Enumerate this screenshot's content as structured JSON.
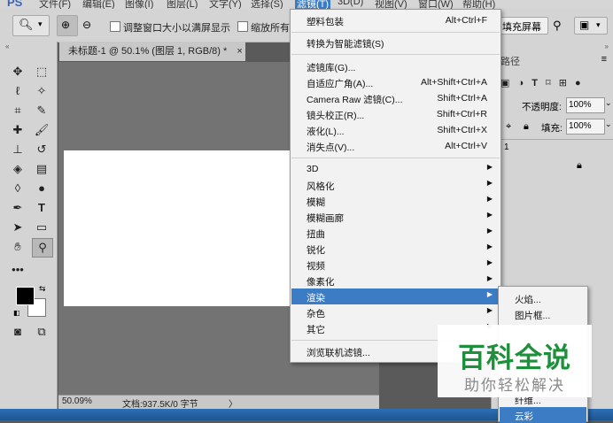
{
  "menubar": {
    "app_logo": "PS",
    "items": [
      "文件(F)",
      "编辑(E)",
      "图像(I)",
      "图层(L)",
      "文字(Y)",
      "选择(S)",
      "滤镜(T)",
      "3D(D)",
      "视图(V)",
      "窗口(W)",
      "帮助(H)"
    ]
  },
  "options_bar": {
    "resize_windows_label": "调整窗口大小以满屏显示",
    "zoom_all_label": "缩放所有",
    "fill_screen_label": "填充屏幕"
  },
  "document": {
    "tab_title": "未标题-1 @ 50.1% (图层 1, RGB/8) *",
    "close_glyph": "×"
  },
  "status_bar": {
    "zoom": "50.09%",
    "doc_info": "文档:937.5K/0 字节",
    "arrow": "〉"
  },
  "right_panel": {
    "paths_tab": "路径",
    "opacity_label": "不透明度:",
    "opacity_value": "100%",
    "fill_label": "填充:",
    "fill_value": "100%",
    "layer_num": "1"
  },
  "filter_menu": {
    "items": [
      {
        "label": "塑料包装",
        "shortcut": "Alt+Ctrl+F"
      },
      {
        "label": "转换为智能滤镜(S)",
        "shortcut": ""
      },
      {
        "label": "滤镜库(G)...",
        "shortcut": ""
      },
      {
        "label": "自适应广角(A)...",
        "shortcut": "Alt+Shift+Ctrl+A"
      },
      {
        "label": "Camera Raw 滤镜(C)...",
        "shortcut": "Shift+Ctrl+A"
      },
      {
        "label": "镜头校正(R)...",
        "shortcut": "Shift+Ctrl+R"
      },
      {
        "label": "液化(L)...",
        "shortcut": "Shift+Ctrl+X"
      },
      {
        "label": "消失点(V)...",
        "shortcut": "Alt+Ctrl+V"
      },
      {
        "label": "3D",
        "shortcut": ""
      },
      {
        "label": "风格化",
        "shortcut": ""
      },
      {
        "label": "模糊",
        "shortcut": ""
      },
      {
        "label": "模糊画廊",
        "shortcut": ""
      },
      {
        "label": "扭曲",
        "shortcut": ""
      },
      {
        "label": "锐化",
        "shortcut": ""
      },
      {
        "label": "视频",
        "shortcut": ""
      },
      {
        "label": "像素化",
        "shortcut": ""
      },
      {
        "label": "渲染",
        "shortcut": ""
      },
      {
        "label": "杂色",
        "shortcut": ""
      },
      {
        "label": "其它",
        "shortcut": ""
      },
      {
        "label": "浏览联机滤镜...",
        "shortcut": ""
      }
    ]
  },
  "render_submenu": {
    "items": [
      "火焰...",
      "图片框...",
      "纤维...",
      "云彩"
    ]
  },
  "watermark": {
    "title": "百科全说",
    "subtitle": "助你轻松解决"
  },
  "colors": {
    "menu_highlight": "#3c7cc4",
    "watermark_green": "#1e8f3a"
  }
}
